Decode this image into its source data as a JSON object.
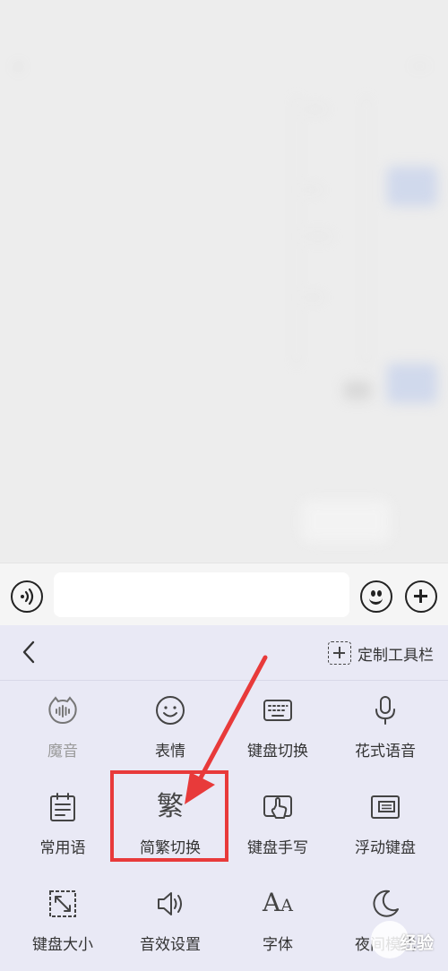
{
  "chat": {
    "status_time": "",
    "status_right": "",
    "nav_title": "",
    "back_glyph": "‹",
    "more_glyph": "···"
  },
  "input_bar": {
    "value": "",
    "placeholder": ""
  },
  "toolbar": {
    "customize_label": "定制工具栏"
  },
  "tools": [
    {
      "label": "魔音",
      "icon": "voice-changer-icon",
      "disabled": true
    },
    {
      "label": "表情",
      "icon": "smiley-icon",
      "disabled": false
    },
    {
      "label": "键盘切换",
      "icon": "keyboard-icon",
      "disabled": false
    },
    {
      "label": "花式语音",
      "icon": "microphone-icon",
      "disabled": false
    },
    {
      "label": "常用语",
      "icon": "phrase-note-icon",
      "disabled": false
    },
    {
      "label": "简繁切换",
      "icon": "traditional-char-icon",
      "glyph": "繁",
      "disabled": false
    },
    {
      "label": "键盘手写",
      "icon": "handwriting-icon",
      "disabled": false
    },
    {
      "label": "浮动键盘",
      "icon": "floating-keyboard-icon",
      "disabled": false
    },
    {
      "label": "键盘大小",
      "icon": "resize-icon",
      "disabled": false
    },
    {
      "label": "音效设置",
      "icon": "speaker-icon",
      "disabled": false
    },
    {
      "label": "字体",
      "icon": "font-icon",
      "glyph_big": "A",
      "glyph_small": "A",
      "disabled": false
    },
    {
      "label": "夜间模式",
      "icon": "moon-icon",
      "disabled": false
    }
  ],
  "annotation": {
    "highlight_color": "#e83a3a"
  },
  "watermark": {
    "text": "经验"
  },
  "colors": {
    "panel_bg": "#e9e9f5",
    "chat_bubble": "#b9c8ec"
  }
}
